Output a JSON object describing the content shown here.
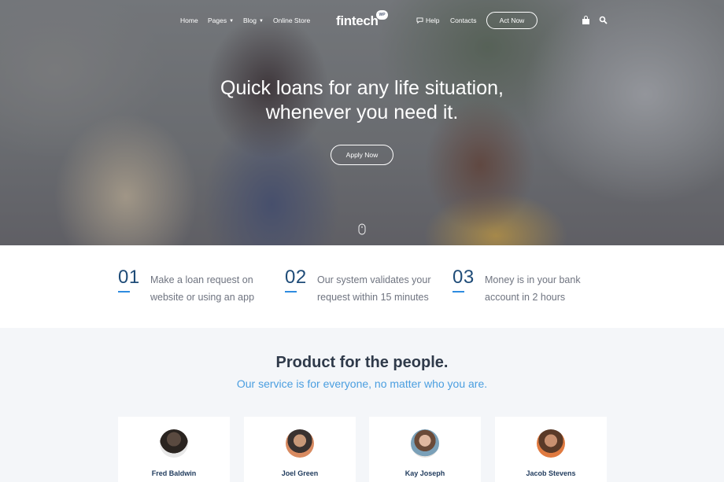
{
  "nav": {
    "home": "Home",
    "pages": "Pages",
    "blog": "Blog",
    "online_store": "Online Store",
    "logo": "fintech",
    "logo_badge": "WP",
    "help": "Help",
    "contacts": "Contacts",
    "act_now": "Act Now"
  },
  "hero": {
    "title_line1": "Quick loans for any life situation,",
    "title_line2": "whenever you need it.",
    "apply_label": "Apply Now"
  },
  "steps": [
    {
      "number": "01",
      "text": "Make a loan request on website or using an app"
    },
    {
      "number": "02",
      "text": "Our system validates your request within 15 minutes"
    },
    {
      "number": "03",
      "text": "Money is in your bank account in 2 hours"
    }
  ],
  "product": {
    "title": "Product for the people.",
    "subtitle": "Our service is for everyone, no matter who you are."
  },
  "team": [
    {
      "name": "Fred Baldwin"
    },
    {
      "name": "Joel Green"
    },
    {
      "name": "Kay Joseph"
    },
    {
      "name": "Jacob Stevens"
    }
  ],
  "icons": {
    "help": "chat-bubble-icon",
    "cart": "shopping-bag-icon",
    "search": "search-icon",
    "scroll": "mouse-icon"
  },
  "colors": {
    "accent_blue": "#2e8ce0",
    "number_navy": "#1f4c78",
    "subtitle_blue": "#4a9ee0"
  }
}
